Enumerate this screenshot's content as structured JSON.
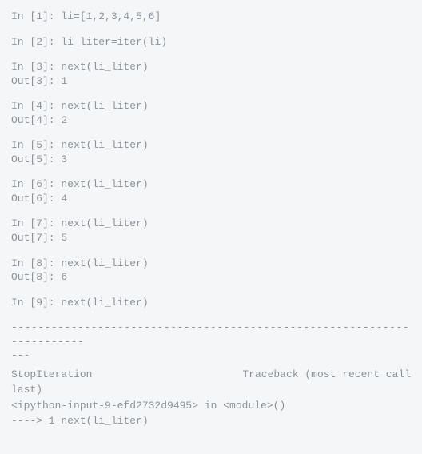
{
  "cells": [
    {
      "in_prompt": "In [1]: ",
      "in_code": "li=[1,2,3,4,5,6]",
      "out_prompt": "",
      "out_value": ""
    },
    {
      "in_prompt": "In [2]: ",
      "in_code": "li_liter=iter(li)",
      "out_prompt": "",
      "out_value": ""
    },
    {
      "in_prompt": "In [3]: ",
      "in_code": "next(li_liter)",
      "out_prompt": "Out[3]: ",
      "out_value": "1"
    },
    {
      "in_prompt": "In [4]: ",
      "in_code": "next(li_liter)",
      "out_prompt": "Out[4]: ",
      "out_value": "2"
    },
    {
      "in_prompt": "In [5]: ",
      "in_code": "next(li_liter)",
      "out_prompt": "Out[5]: ",
      "out_value": "3"
    },
    {
      "in_prompt": "In [6]: ",
      "in_code": "next(li_liter)",
      "out_prompt": "Out[6]: ",
      "out_value": "4"
    },
    {
      "in_prompt": "In [7]: ",
      "in_code": "next(li_liter)",
      "out_prompt": "Out[7]: ",
      "out_value": "5"
    },
    {
      "in_prompt": "In [8]: ",
      "in_code": "next(li_liter)",
      "out_prompt": "Out[8]: ",
      "out_value": "6"
    },
    {
      "in_prompt": "In [9]: ",
      "in_code": "next(li_liter)",
      "out_prompt": "",
      "out_value": ""
    }
  ],
  "dashes_line1": "-----------------------------------------------------------------------",
  "dashes_line2": "---",
  "trace_exc": "StopIteration",
  "trace_right": "Traceback (most recent call",
  "trace_last": "last)",
  "trace_file": "<ipython-input-9-efd2732d9495> in <module>()",
  "trace_arrow": "----> 1 next(li_liter)"
}
